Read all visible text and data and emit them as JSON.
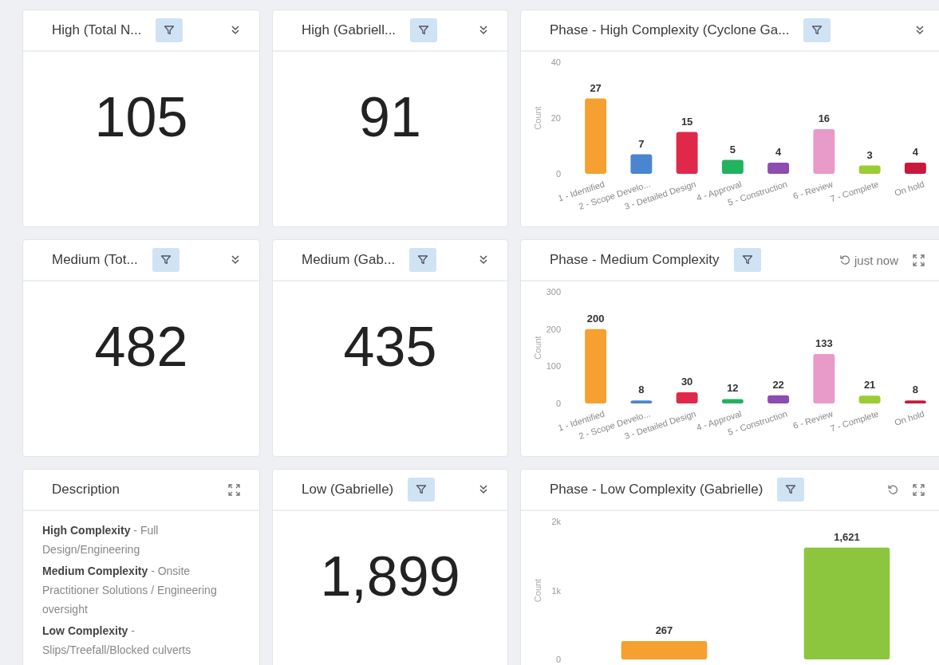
{
  "tiles": [
    {
      "kind": "kpi",
      "title": "High (Total N...",
      "filter": true,
      "actions": [
        {
          "kind": "collapse"
        }
      ],
      "value": "105"
    },
    {
      "kind": "kpi",
      "title": "High (Gabriell...",
      "filter": true,
      "actions": [
        {
          "kind": "collapse"
        }
      ],
      "value": "91"
    },
    {
      "kind": "chart",
      "title": "Phase - High Complexity (Cyclone Ga...",
      "filter": true,
      "actions": [
        {
          "kind": "collapse"
        }
      ],
      "chart_data": {
        "type": "bar",
        "ylabel": "Count",
        "categories": [
          "1 - Identified",
          "2 - Scope Develo...",
          "3 - Detailed Design",
          "4 - Approval",
          "5 - Construction",
          "6 - Review",
          "7 - Complete",
          "On hold"
        ],
        "values": [
          27,
          7,
          15,
          5,
          4,
          16,
          3,
          4
        ],
        "colors": [
          "#f5a030",
          "#4a86d0",
          "#e0294a",
          "#22b35e",
          "#8e4bb0",
          "#e89ac8",
          "#9acd32",
          "#c8193c"
        ],
        "ylim": [
          0,
          40
        ],
        "yticks": [
          0,
          20,
          40
        ],
        "value_labels": [
          "27",
          "7",
          "15",
          "5",
          "4",
          "16",
          "3",
          "4"
        ]
      }
    },
    {
      "kind": "kpi",
      "title": "Medium (Tot...",
      "filter": true,
      "actions": [
        {
          "kind": "collapse"
        }
      ],
      "value": "482"
    },
    {
      "kind": "kpi",
      "title": "Medium (Gab...",
      "filter": true,
      "actions": [
        {
          "kind": "collapse"
        }
      ],
      "value": "435"
    },
    {
      "kind": "chart",
      "title": "Phase - Medium Complexity",
      "filter": true,
      "actions": [
        {
          "kind": "refresh",
          "label": "just now"
        },
        {
          "kind": "expand"
        }
      ],
      "chart_data": {
        "type": "bar",
        "ylabel": "Count",
        "categories": [
          "1 - Identified",
          "2 - Scope Develo...",
          "3 - Detailed Design",
          "4 - Approval",
          "5 - Construction",
          "6 - Review",
          "7 - Complete",
          "On hold"
        ],
        "values": [
          200,
          8,
          30,
          12,
          22,
          133,
          21,
          8
        ],
        "colors": [
          "#f5a030",
          "#4a86d0",
          "#e0294a",
          "#22b35e",
          "#8e4bb0",
          "#e89ac8",
          "#9acd32",
          "#c8193c"
        ],
        "ylim": [
          0,
          300
        ],
        "yticks": [
          0,
          100,
          200,
          300
        ],
        "value_labels": [
          "200",
          "8",
          "30",
          "12",
          "22",
          "133",
          "21",
          "8"
        ]
      }
    },
    {
      "kind": "text",
      "title": "Description",
      "filter": false,
      "actions": [
        {
          "kind": "expand"
        }
      ],
      "paragraphs": [
        "**High Complexity** - Full Design/Engineering",
        "**Medium Complexity** - Onsite Practitioner Solutions / Engineering oversight",
        "**Low Complexity** - Slips/Treefall/Blocked culverts"
      ]
    },
    {
      "kind": "kpi",
      "title": "Low (Gabrielle)",
      "filter": true,
      "actions": [
        {
          "kind": "collapse"
        }
      ],
      "value": "1,899"
    },
    {
      "kind": "chart",
      "title": "Phase - Low Complexity (Gabrielle)",
      "filter": true,
      "actions": [
        {
          "kind": "refresh"
        },
        {
          "kind": "expand"
        }
      ],
      "chart_data": {
        "type": "bar",
        "ylabel": "Count",
        "values": [
          267,
          1621
        ],
        "colors": [
          "#f5a030",
          "#8cc63f"
        ],
        "ylim": [
          0,
          2000
        ],
        "yticks": [
          0,
          {
            "value": 1000,
            "label": "1k"
          },
          {
            "value": 2000,
            "label": "2k"
          }
        ],
        "value_labels": [
          "267",
          "1,621"
        ]
      }
    }
  ]
}
